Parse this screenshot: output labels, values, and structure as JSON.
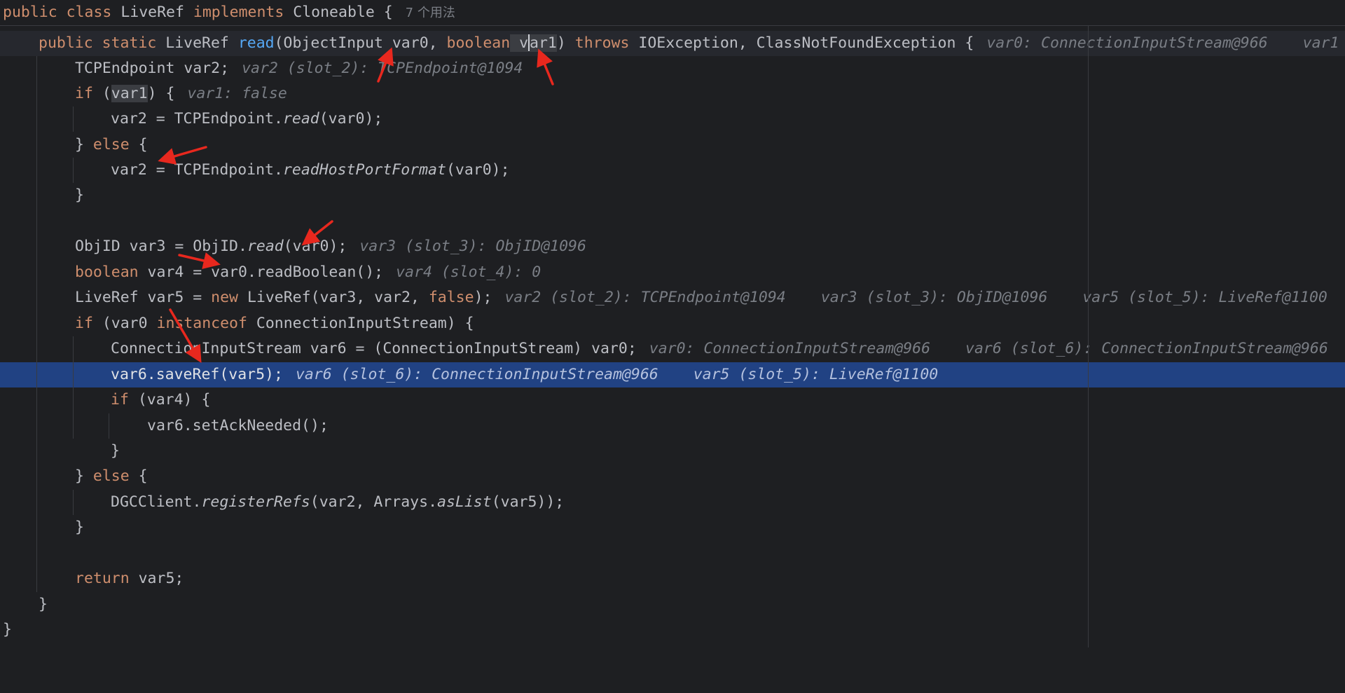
{
  "editor": {
    "header": {
      "kw_public": "public",
      "kw_class": "class",
      "class_name": "LiveRef",
      "kw_implements": "implements",
      "iface": "Cloneable {",
      "usages": "7 个用法"
    },
    "sig": {
      "kw_public": "public",
      "kw_static": "static",
      "ret_type": "LiveRef",
      "method": "read",
      "params_a": "(ObjectInput var0, ",
      "kw_boolean": "boolean",
      "param_b_pre": " v",
      "param_b_post": "ar1",
      "params_c": ") ",
      "kw_throws": "throws",
      "exceptions": " IOException, ClassNotFoundException {",
      "hint1": "var0: ConnectionInputStream@966",
      "hint2": "var1"
    },
    "l2": {
      "code": "TCPEndpoint var2;",
      "hint": "var2 (slot_2): TCPEndpoint@1094"
    },
    "l3": {
      "kw_if": "if",
      "open": " (",
      "var": "var1",
      "close": ") {",
      "hint": "var1: false"
    },
    "l4": {
      "pre": "var2 = TCPEndpoint.",
      "call": "read",
      "post": "(var0);"
    },
    "l5": {
      "brace": "} ",
      "kw_else": "else",
      "open": " {"
    },
    "l6": {
      "pre": "var2 = TCPEndpoint.",
      "call": "readHostPortFormat",
      "post": "(var0);"
    },
    "l7": {
      "code": "}"
    },
    "l9": {
      "pre": "ObjID var3 = ObjID.",
      "call": "read",
      "post": "(var0);",
      "hint": "var3 (slot_3): ObjID@1096"
    },
    "l10": {
      "kw_boolean": "boolean",
      "code": " var4 = var0.readBoolean();",
      "hint": "var4 (slot_4): 0"
    },
    "l11": {
      "pre": "LiveRef var5 = ",
      "kw_new": "new",
      "mid": " LiveRef(var3, var2, ",
      "kw_false": "false",
      "post": ");",
      "hint1": "var2 (slot_2): TCPEndpoint@1094",
      "hint2": "var3 (slot_3): ObjID@1096",
      "hint3": "var5 (slot_5): LiveRef@1100"
    },
    "l12": {
      "kw_if": "if",
      "pre": " (var0 ",
      "kw_instanceof": "instanceof",
      "post": " ConnectionInputStream) {"
    },
    "l13": {
      "code": "ConnectionInputStream var6 = (ConnectionInputStream) var0;",
      "hint1": "var0: ConnectionInputStream@966",
      "hint2": "var6 (slot_6): ConnectionInputStream@966"
    },
    "l14": {
      "code": "var6.saveRef(var5);",
      "hint1": "var6 (slot_6): ConnectionInputStream@966",
      "hint2": "var5 (slot_5): LiveRef@1100"
    },
    "l15": {
      "kw_if": "if",
      "code": " (var4) {"
    },
    "l16": {
      "code": "var6.setAckNeeded();"
    },
    "l17": {
      "code": "}"
    },
    "l18": {
      "brace": "} ",
      "kw_else": "else",
      "open": " {"
    },
    "l19": {
      "pre": "DGCClient.",
      "call1": "registerRefs",
      "mid": "(var2, Arrays.",
      "call2": "asList",
      "post": "(var5));"
    },
    "l20": {
      "code": "}"
    },
    "l22": {
      "kw_return": "return",
      "code": " var5;"
    },
    "l23": {
      "code": "}"
    },
    "l24": {
      "code": "}"
    }
  },
  "colors": {
    "background": "#1e1f22",
    "keyword": "#cf8e6d",
    "method_decl": "#56a8f5",
    "inlay_hint": "#7a7e85",
    "execution_line": "#214283",
    "annotation_arrow": "#e8281e"
  }
}
